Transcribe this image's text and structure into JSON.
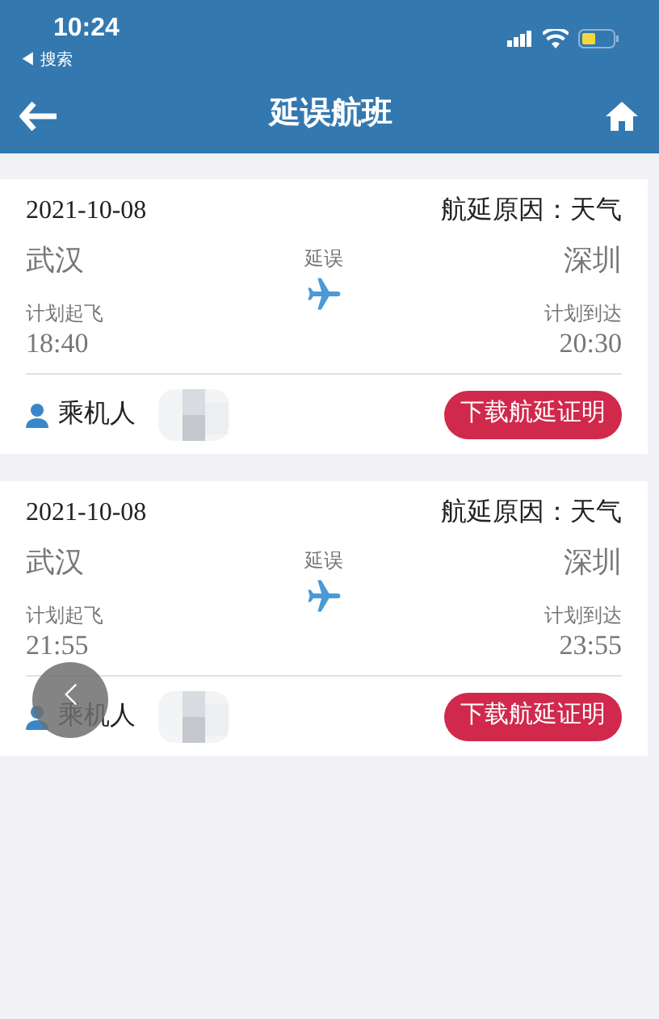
{
  "status_bar": {
    "time": "10:24",
    "back_app": "◀ 搜索"
  },
  "header": {
    "title": "延误航班"
  },
  "flights": [
    {
      "date": "2021-10-08",
      "reason": "航延原因：天气",
      "from": "武汉",
      "to": "深圳",
      "status": "延误",
      "dep_label": "计划起飞",
      "dep_time": "18:40",
      "arr_label": "计划到达",
      "arr_time": "20:30",
      "passenger_label": "乘机人",
      "button": "下载航延证明"
    },
    {
      "date": "2021-10-08",
      "reason": "航延原因：天气",
      "from": "武汉",
      "to": "深圳",
      "status": "延误",
      "dep_label": "计划起飞",
      "dep_time": "21:55",
      "arr_label": "计划到达",
      "arr_time": "23:55",
      "passenger_label": "乘机人",
      "button": "下载航延证明"
    }
  ]
}
